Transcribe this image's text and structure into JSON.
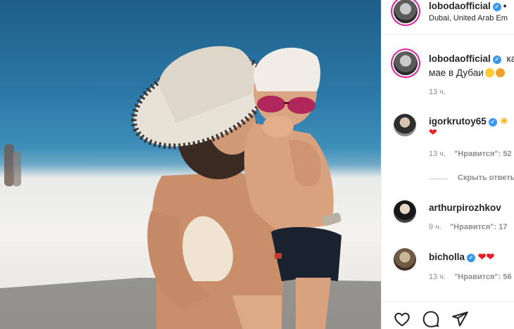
{
  "post": {
    "author": "lobodaofficial",
    "location": "Dubai, United Arab Em",
    "caption": {
      "username": "lobodaofficial",
      "line1": "ка",
      "line2": "мае в Дубаи",
      "time": "13 ч."
    }
  },
  "comments": [
    {
      "username": "igorkrutoy65",
      "time": "13 ч.",
      "likes": "\"Нравится\": 52",
      "hide_replies": "Скрыть ответы"
    },
    {
      "username": "arthurpirozhkov",
      "time": "9 ч.",
      "likes": "\"Нравится\": 17"
    },
    {
      "username": "bicholla",
      "time": "13 ч.",
      "likes": "\"Нравится\": 56"
    }
  ],
  "actions": {
    "like_icon": "heart-outline-icon",
    "comment_icon": "speech-bubble-icon",
    "share_icon": "paper-plane-icon"
  },
  "colors": {
    "verified": "#3897f0",
    "heart": "#ed1c24",
    "story_ring": "#d6249f",
    "meta_text": "#8e8e8e"
  }
}
